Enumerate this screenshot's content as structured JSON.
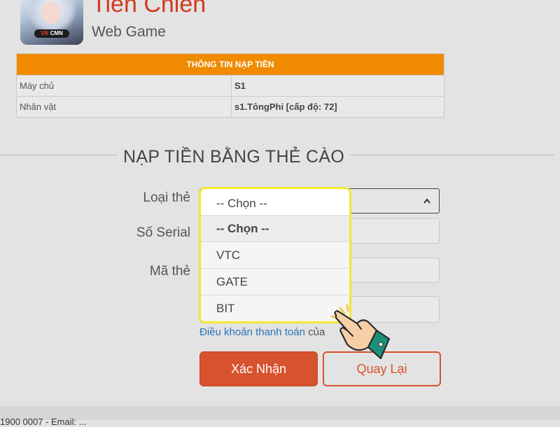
{
  "header": {
    "title": "Tiên Chiến",
    "subtitle": "Web Game",
    "logo_badge_a": "CMN",
    "logo_badge_b": "VN"
  },
  "info_table": {
    "heading": "THÔNG TIN NẠP TIỀN",
    "rows": [
      {
        "label": "Máy chủ",
        "value": "S1"
      },
      {
        "label": "Nhân vật",
        "value": "s1.TôngPhi [cấp độ: 72]"
      }
    ]
  },
  "section": {
    "title": "NẠP TIỀN BẰNG THẺ CÀO"
  },
  "form": {
    "card_type_label": "Loại thẻ",
    "serial_label": "Số Serial",
    "code_label": "Mã thẻ",
    "select": {
      "value": "-- Chọn --",
      "options": [
        "-- Chọn --",
        "VTC",
        "GATE",
        "BIT"
      ],
      "selected_index": 0
    },
    "terms_link": "Điều khoản thanh toán",
    "terms_suffix": " của"
  },
  "buttons": {
    "confirm": "Xác Nhận",
    "back": "Quay Lại"
  },
  "footer": {
    "text": "1900 0007 - Email: ..."
  },
  "colors": {
    "table_header": "#f08a00",
    "title": "#d23a1e",
    "confirm_button": "#d7522e",
    "dropdown_highlight": "#f4ec1a",
    "link": "#2a73b8"
  },
  "icons": {
    "select_arrow": "chevron-up-icon",
    "pointer": "pointing-hand-icon"
  }
}
